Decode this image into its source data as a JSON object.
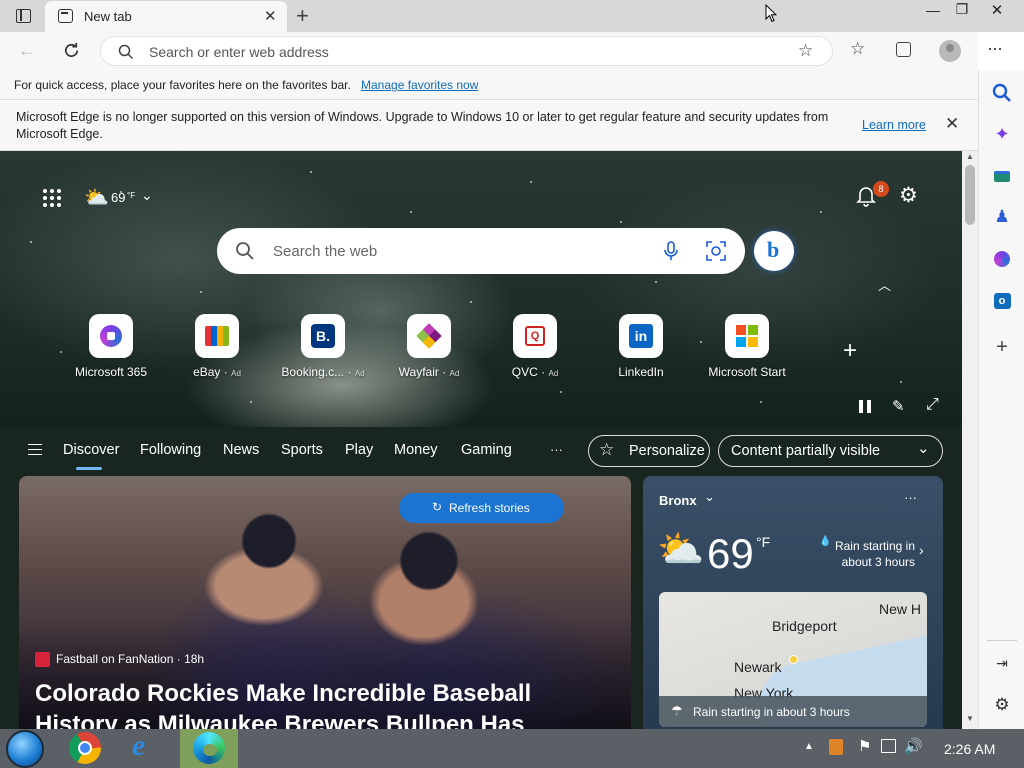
{
  "tab": {
    "title": "New tab",
    "close": "✕",
    "new": "+"
  },
  "window": {
    "minimize": "—",
    "restore": "❐",
    "close": "✕"
  },
  "address": {
    "placeholder": "Search or enter web address"
  },
  "favorites_bar": {
    "text": "For quick access, place your favorites here on the favorites bar.",
    "link": "Manage favorites now"
  },
  "infobar": {
    "message": "Microsoft Edge is no longer supported on this version of Windows. Upgrade to Windows 10 or later to get regular feature and security updates from Microsoft Edge.",
    "link": "Learn more"
  },
  "ntp": {
    "weather_temp": "69",
    "weather_unit": "°F",
    "notification_count": "8",
    "search_placeholder": "Search the web",
    "quick_links": [
      {
        "label": "Microsoft 365",
        "ad": ""
      },
      {
        "label": "eBay",
        "ad": "Ad"
      },
      {
        "label": "Booking.c...",
        "ad": "Ad"
      },
      {
        "label": "Wayfair",
        "ad": "Ad"
      },
      {
        "label": "QVC",
        "ad": "Ad"
      },
      {
        "label": "LinkedIn",
        "ad": ""
      },
      {
        "label": "Microsoft Start",
        "ad": ""
      }
    ],
    "nav_tabs": [
      "Discover",
      "Following",
      "News",
      "Sports",
      "Play",
      "Money",
      "Gaming",
      "···"
    ],
    "personalize": "Personalize",
    "content_visibility": "Content partially visible",
    "refresh": "Refresh stories",
    "story": {
      "source": "Fastball on FanNation · 18h",
      "headline": "Colorado Rockies Make Incredible Baseball History as Milwaukee Brewers Bullpen Has Historic"
    },
    "weather_card": {
      "location": "Bronx",
      "temp": "69",
      "unit": "°F",
      "forecast": "Rain starting in about 3 hours",
      "map_labels": [
        "New H",
        "Bridgeport",
        "Newark",
        "New York"
      ],
      "map_banner": "Rain starting in about 3 hours"
    }
  },
  "taskbar": {
    "time": "2:26 AM"
  },
  "colors": {
    "accent": "#0f6cbd",
    "link": "#0f6cbd",
    "refresh_pill": "#1b74d1"
  }
}
